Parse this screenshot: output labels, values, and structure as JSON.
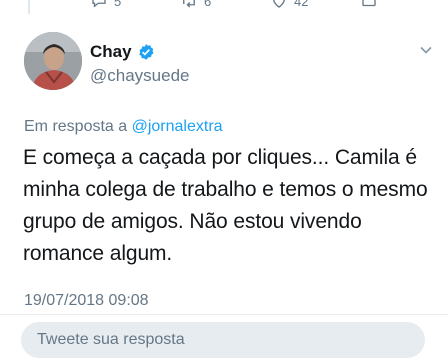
{
  "previous_tweet": {
    "reply_count": "5",
    "retweet_count": "6",
    "like_count": "42"
  },
  "author": {
    "name": "Chay",
    "handle": "@chaysuede",
    "verified": true
  },
  "tweet": {
    "reply_prefix": "Em resposta a ",
    "reply_mention": "@jornalextra",
    "text": "E começa a caçada por cliques... Camila é minha colega de trabalho e temos o mesmo grupo de amigos. Não estou vivendo romance algum.",
    "timestamp": "19/07/2018 09:08"
  },
  "reply_input": {
    "placeholder": "Tweete sua resposta"
  },
  "colors": {
    "text": "#14171a",
    "secondary": "#657786",
    "accent": "#1da1f2",
    "input_bg": "#e6ecf0"
  },
  "icons": [
    "reply-icon",
    "retweet-icon",
    "like-icon",
    "share-icon",
    "verified-badge-icon",
    "chevron-down-icon"
  ]
}
